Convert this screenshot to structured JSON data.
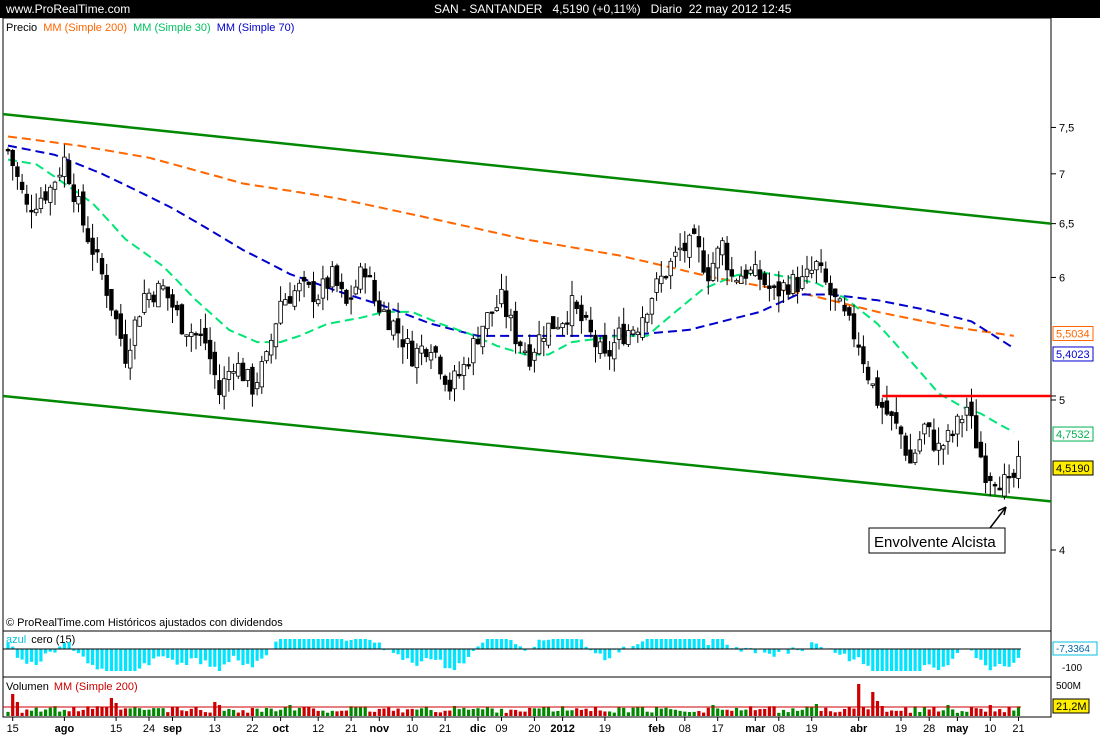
{
  "header": {
    "site": "www.ProRealTime.com",
    "symbol": "SAN - SANTANDER",
    "price_change": "4,5190 (+0,11%)",
    "period": "Diario",
    "datetime": "22 may 2012 12:45"
  },
  "legend": {
    "precio": "Precio",
    "mm200": "MM (Simple 200)",
    "mm30": "MM (Simple 30)",
    "mm70": "MM (Simple 70)"
  },
  "colors": {
    "up": "#ffffff",
    "down": "#000000",
    "mm200": "#ff6600",
    "mm30": "#00e676",
    "mm70": "#0000cc",
    "channel": "#008800",
    "resistance": "#ff0000",
    "osc": "#00e5ff",
    "vol_up": "#008800",
    "vol_down": "#cc0000"
  },
  "price_axis": {
    "ticks": [
      "7,5",
      "7",
      "6,5",
      "6",
      "5",
      "4"
    ],
    "min": 4,
    "max": 7.7,
    "scale": "log"
  },
  "badges": {
    "mm200": "5,5034",
    "mm70": "5,4023",
    "resistance": "5",
    "mm30": "4,7532",
    "last": "4,5190"
  },
  "annotation": "Envolvente Alcista",
  "copyright": "© ProRealTime.com Históricos ajustados con dividendos",
  "osc_panel": {
    "label_a": "azul",
    "label_b": "cero (15)",
    "value": "-7,3364",
    "scale_label": "-100"
  },
  "vol_panel": {
    "label_a": "Volumen",
    "label_b": "MM (Simple 200)",
    "scale_label": "500M",
    "value": "21,2M"
  },
  "x_axis": [
    {
      "label": "15",
      "i": 1
    },
    {
      "label": "ago",
      "i": 12,
      "bold": true
    },
    {
      "label": "15",
      "i": 23
    },
    {
      "label": "24",
      "i": 30
    },
    {
      "label": "sep",
      "i": 35,
      "bold": true
    },
    {
      "label": "13",
      "i": 44
    },
    {
      "label": "22",
      "i": 52
    },
    {
      "label": "oct",
      "i": 58,
      "bold": true
    },
    {
      "label": "12",
      "i": 66
    },
    {
      "label": "21",
      "i": 73
    },
    {
      "label": "nov",
      "i": 79,
      "bold": true
    },
    {
      "label": "10",
      "i": 86
    },
    {
      "label": "21",
      "i": 93
    },
    {
      "label": "dic",
      "i": 100,
      "bold": true
    },
    {
      "label": "09",
      "i": 105
    },
    {
      "label": "20",
      "i": 112
    },
    {
      "label": "2012",
      "i": 118,
      "bold": true
    },
    {
      "label": "19",
      "i": 127
    },
    {
      "label": "feb",
      "i": 138,
      "bold": true
    },
    {
      "label": "08",
      "i": 144
    },
    {
      "label": "17",
      "i": 151
    },
    {
      "label": "mar",
      "i": 159,
      "bold": true
    },
    {
      "label": "08",
      "i": 164
    },
    {
      "label": "19",
      "i": 171
    },
    {
      "label": "abr",
      "i": 181,
      "bold": true
    },
    {
      "label": "19",
      "i": 190
    },
    {
      "label": "28",
      "i": 196
    },
    {
      "label": "may",
      "i": 202,
      "bold": true
    },
    {
      "label": "10",
      "i": 209
    },
    {
      "label": "21",
      "i": 215
    }
  ],
  "chart_data": {
    "type": "candlestick",
    "title": "SAN - SANTANDER",
    "ylabel": "Precio",
    "bars": 216,
    "close_anchors": [
      [
        0,
        7.25
      ],
      [
        4,
        6.65
      ],
      [
        9,
        6.85
      ],
      [
        12,
        7.15
      ],
      [
        16,
        6.5
      ],
      [
        21,
        5.9
      ],
      [
        25,
        5.35
      ],
      [
        29,
        5.85
      ],
      [
        33,
        5.9
      ],
      [
        37,
        5.6
      ],
      [
        42,
        5.45
      ],
      [
        45,
        5.05
      ],
      [
        48,
        5.3
      ],
      [
        52,
        5.1
      ],
      [
        55,
        5.3
      ],
      [
        58,
        5.8
      ],
      [
        62,
        5.9
      ],
      [
        66,
        5.85
      ],
      [
        69,
        6.0
      ],
      [
        72,
        5.75
      ],
      [
        76,
        6.1
      ],
      [
        78,
        5.8
      ],
      [
        82,
        5.6
      ],
      [
        86,
        5.35
      ],
      [
        90,
        5.45
      ],
      [
        94,
        5.1
      ],
      [
        97,
        5.25
      ],
      [
        101,
        5.6
      ],
      [
        105,
        5.8
      ],
      [
        108,
        5.5
      ],
      [
        111,
        5.35
      ],
      [
        114,
        5.55
      ],
      [
        118,
        5.65
      ],
      [
        120,
        5.75
      ],
      [
        124,
        5.5
      ],
      [
        127,
        5.3
      ],
      [
        130,
        5.5
      ],
      [
        134,
        5.6
      ],
      [
        137,
        5.85
      ],
      [
        140,
        6.05
      ],
      [
        143,
        6.25
      ],
      [
        146,
        6.3
      ],
      [
        149,
        6.05
      ],
      [
        152,
        6.3
      ],
      [
        154,
        6.0
      ],
      [
        157,
        6.05
      ],
      [
        160,
        6.0
      ],
      [
        163,
        5.85
      ],
      [
        166,
        5.95
      ],
      [
        169,
        5.95
      ],
      [
        172,
        6.1
      ],
      [
        175,
        5.85
      ],
      [
        178,
        5.65
      ],
      [
        181,
        5.45
      ],
      [
        183,
        5.2
      ],
      [
        185,
        5.0
      ],
      [
        187,
        4.9
      ],
      [
        190,
        4.75
      ],
      [
        192,
        4.55
      ],
      [
        195,
        4.8
      ],
      [
        198,
        4.65
      ],
      [
        201,
        4.75
      ],
      [
        204,
        4.95
      ],
      [
        206,
        4.7
      ],
      [
        208,
        4.5
      ],
      [
        211,
        4.45
      ],
      [
        213,
        4.38
      ],
      [
        215,
        4.52
      ]
    ],
    "mm200_anchors": [
      [
        0,
        7.4
      ],
      [
        15,
        7.3
      ],
      [
        30,
        7.17
      ],
      [
        50,
        6.9
      ],
      [
        70,
        6.75
      ],
      [
        90,
        6.55
      ],
      [
        110,
        6.35
      ],
      [
        130,
        6.2
      ],
      [
        150,
        6.0
      ],
      [
        170,
        5.85
      ],
      [
        185,
        5.7
      ],
      [
        200,
        5.58
      ],
      [
        214,
        5.5
      ]
    ],
    "mm70_anchors": [
      [
        0,
        7.3
      ],
      [
        10,
        7.2
      ],
      [
        20,
        7.0
      ],
      [
        35,
        6.65
      ],
      [
        50,
        6.25
      ],
      [
        60,
        6.03
      ],
      [
        70,
        5.88
      ],
      [
        80,
        5.75
      ],
      [
        90,
        5.6
      ],
      [
        100,
        5.5
      ],
      [
        115,
        5.5
      ],
      [
        130,
        5.5
      ],
      [
        145,
        5.55
      ],
      [
        160,
        5.7
      ],
      [
        168,
        5.85
      ],
      [
        175,
        5.85
      ],
      [
        185,
        5.8
      ],
      [
        195,
        5.72
      ],
      [
        205,
        5.62
      ],
      [
        214,
        5.4
      ]
    ],
    "mm30_anchors": [
      [
        0,
        7.15
      ],
      [
        6,
        7.1
      ],
      [
        12,
        6.9
      ],
      [
        18,
        6.7
      ],
      [
        25,
        6.35
      ],
      [
        33,
        6.1
      ],
      [
        40,
        5.8
      ],
      [
        47,
        5.55
      ],
      [
        53,
        5.45
      ],
      [
        58,
        5.45
      ],
      [
        62,
        5.5
      ],
      [
        68,
        5.6
      ],
      [
        75,
        5.65
      ],
      [
        80,
        5.7
      ],
      [
        86,
        5.7
      ],
      [
        92,
        5.6
      ],
      [
        98,
        5.52
      ],
      [
        104,
        5.42
      ],
      [
        110,
        5.35
      ],
      [
        115,
        5.35
      ],
      [
        120,
        5.45
      ],
      [
        130,
        5.5
      ],
      [
        136,
        5.5
      ],
      [
        142,
        5.7
      ],
      [
        148,
        5.9
      ],
      [
        155,
        6.02
      ],
      [
        160,
        6.05
      ],
      [
        166,
        6.0
      ],
      [
        172,
        5.95
      ],
      [
        178,
        5.82
      ],
      [
        185,
        5.6
      ],
      [
        192,
        5.3
      ],
      [
        198,
        5.05
      ],
      [
        203,
        4.95
      ],
      [
        207,
        4.9
      ],
      [
        211,
        4.82
      ],
      [
        215,
        4.75
      ]
    ],
    "channel_upper": [
      [
        0,
        7.65
      ],
      [
        215,
        6.5
      ]
    ],
    "channel_lower": [
      [
        0,
        5.03
      ],
      [
        215,
        4.3
      ]
    ],
    "resistance": {
      "from": 186,
      "to": 215,
      "value": 5.03
    },
    "last_close": 4.519,
    "oscillator_last": -7.3364,
    "volume_last": "21,2M"
  }
}
